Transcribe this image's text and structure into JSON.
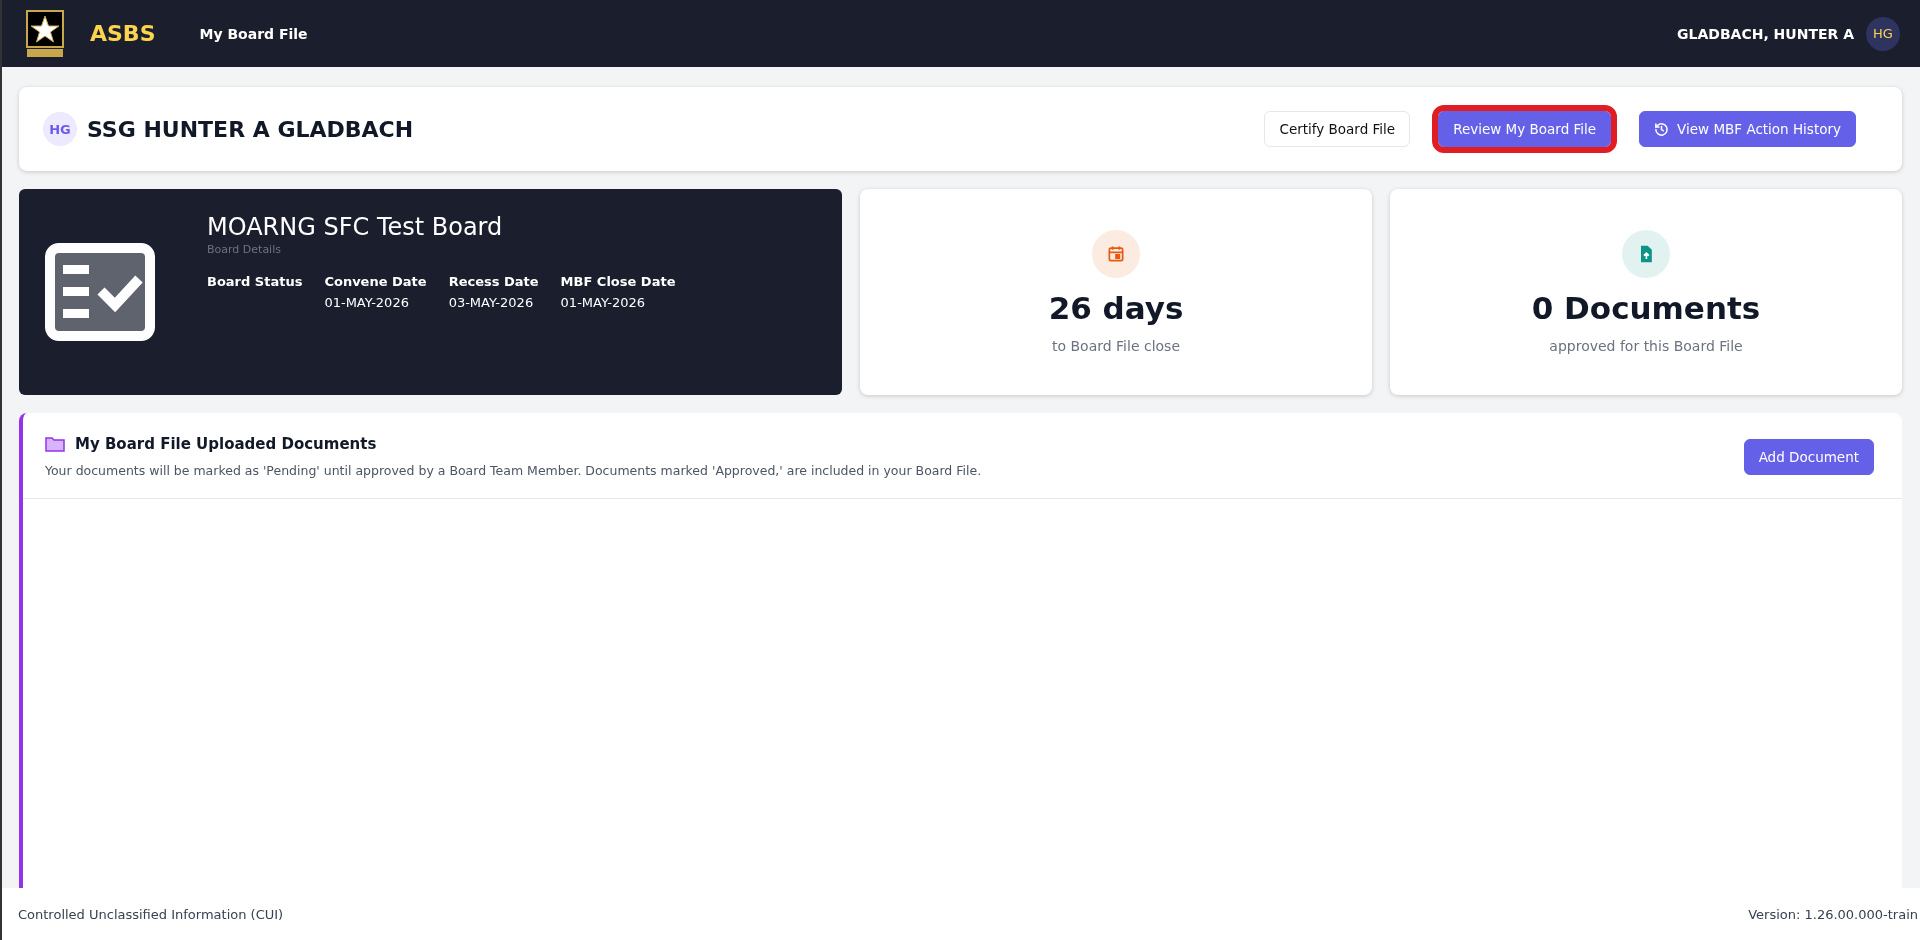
{
  "header": {
    "app_name": "ASBS",
    "nav": [
      {
        "label": "My Board File",
        "selected": true
      }
    ],
    "user_name": "GLADBACH, HUNTER A",
    "user_initials": "HG"
  },
  "profile": {
    "initials": "HG",
    "name": "SSG HUNTER A GLADBACH",
    "buttons": [
      {
        "label": "Certify Board File",
        "kind": "outline",
        "highlighted": false
      },
      {
        "label": "Review My Board File",
        "kind": "primary",
        "highlighted": true
      },
      {
        "label": "View MBF Action History",
        "kind": "history",
        "highlighted": false
      }
    ]
  },
  "board": {
    "title": "MOARNG SFC Test Board",
    "subtitle": "Board Details",
    "fields": [
      {
        "label": "Board Status"
      },
      {
        "label": "Convene Date",
        "value": "01-MAY-2026"
      },
      {
        "label": "Recess Date",
        "value": "03-MAY-2026"
      },
      {
        "label": "MBF Close Date",
        "value": "01-MAY-2026"
      }
    ]
  },
  "stats": [
    {
      "kind": "calendar",
      "value": "26 days",
      "caption": "to Board File close",
      "color": "#ea580c"
    },
    {
      "kind": "document",
      "value": "0 Documents",
      "caption": "approved for this Board File",
      "color": "#0d9488"
    }
  ],
  "documents": {
    "title": "My Board File Uploaded Documents",
    "description": "Your documents will be marked as 'Pending' until approved by a Board Team Member. Documents marked 'Approved,' are included in your Board File.",
    "add_button": "Add Document"
  },
  "footer": {
    "classification": "Controlled Unclassified Information (CUI)",
    "version": "Version: 1.26.00.000-train"
  }
}
